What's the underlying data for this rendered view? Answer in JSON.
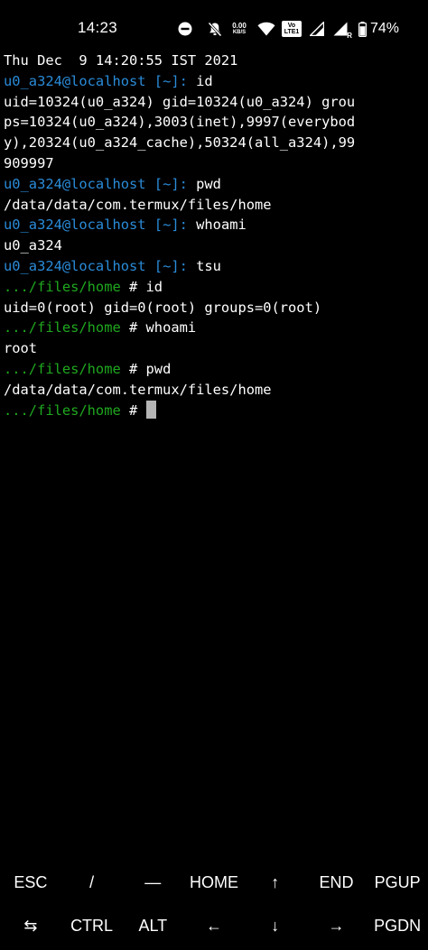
{
  "status_bar": {
    "time": "14:23",
    "network_speed_value": "0.00",
    "network_speed_unit": "KB/S",
    "volte_label_top": "Vo",
    "volte_label_mid": "LTE",
    "volte_label_num": "1",
    "signal_label": "R",
    "battery_percent": "74%",
    "icons": [
      "do-not-disturb-icon",
      "muted-bell-icon",
      "network-speed-indicator",
      "wifi-icon",
      "volte-icon",
      "signal-icon",
      "signal-roaming-icon",
      "battery-icon"
    ]
  },
  "terminal": {
    "date_line": "Thu Dec  9 14:20:55 IST 2021",
    "lines": {
      "l1_user": "u0_a324@localhost ",
      "l1_dir": "[~]: ",
      "l1_cmd": "id",
      "l2": "uid=10324(u0_a324) gid=10324(u0_a324) grou",
      "l3": "ps=10324(u0_a324),3003(inet),9997(everybod",
      "l4": "y),20324(u0_a324_cache),50324(all_a324),99",
      "l5": "909997",
      "l6_user": "u0_a324@localhost ",
      "l6_dir": "[~]: ",
      "l6_cmd": "pwd",
      "l7": "/data/data/com.termux/files/home",
      "l8_user": "u0_a324@localhost ",
      "l8_dir": "[~]: ",
      "l8_cmd": "whoami",
      "l9": "u0_a324",
      "l10_user": "u0_a324@localhost ",
      "l10_dir": "[~]: ",
      "l10_cmd": "tsu",
      "l11_prompt": ".../files/home",
      "l11_cmd": " # id",
      "l12": "uid=0(root) gid=0(root) groups=0(root)",
      "l13_prompt": ".../files/home",
      "l13_cmd": " # whoami",
      "l14": "root",
      "l15_prompt": ".../files/home",
      "l15_cmd": " # pwd",
      "l16": "/data/data/com.termux/files/home",
      "l17_prompt": ".../files/home",
      "l17_cmd": " # "
    },
    "colors": {
      "user_host": "#2a8bd8",
      "prompt_path": "#1fa81f",
      "text": "#ffffff",
      "cursor": "#b5b5b5",
      "background": "#000000"
    }
  },
  "extra_keys": {
    "row1": [
      "ESC",
      "/",
      "—",
      "HOME",
      "↑",
      "END",
      "PGUP"
    ],
    "row2": [
      "⇆",
      "CTRL",
      "ALT",
      "←",
      "↓",
      "→",
      "PGDN"
    ]
  }
}
